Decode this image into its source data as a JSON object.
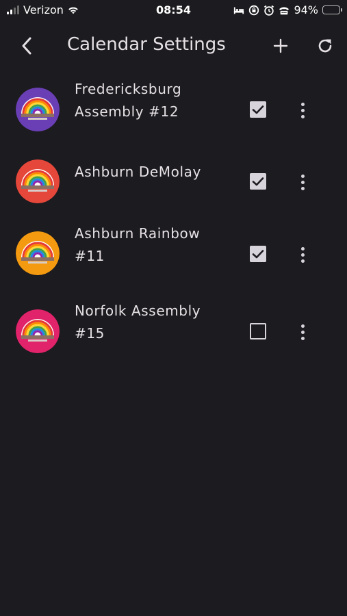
{
  "status_bar": {
    "carrier": "Verizon",
    "time": "08:54",
    "battery": "94%",
    "battery_level": 0.94,
    "icons": [
      "signal-icon",
      "wifi-icon",
      "bed-icon",
      "lock-rotation-icon",
      "alarm-icon",
      "tty-icon",
      "battery-icon"
    ]
  },
  "app_bar": {
    "title": "Calendar Settings",
    "icons": [
      "back-arrow-icon",
      "plus-icon",
      "refresh-icon"
    ]
  },
  "calendars": [
    {
      "name_line1": "Fredericksburg",
      "name_line2": "Assembly #12",
      "checked": true,
      "avatar_color": "#6a3fb5"
    },
    {
      "name_line1": "Ashburn DeMolay",
      "name_line2": "",
      "checked": true,
      "avatar_color": "#e5473b"
    },
    {
      "name_line1": "Ashburn Rainbow",
      "name_line2": "#11",
      "checked": true,
      "avatar_color": "#f39a10"
    },
    {
      "name_line1": "Norfolk Assembly",
      "name_line2": "#15",
      "checked": false,
      "avatar_color": "#e0236a"
    }
  ],
  "colors": {
    "background": "#1c1b1f",
    "text": "#e6e1e5",
    "checkbox": "#d8d4dc",
    "battery_fill": "#ffd60a"
  }
}
